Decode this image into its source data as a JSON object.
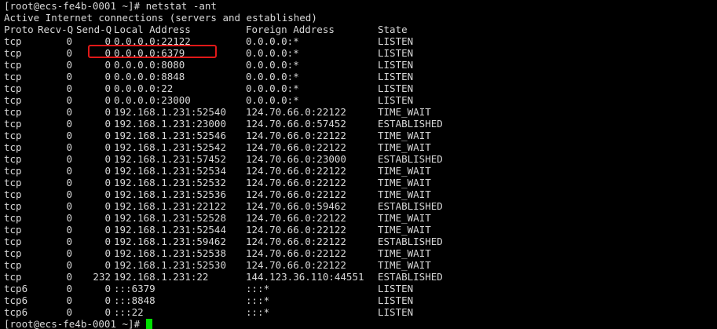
{
  "prompt_line": "[root@ecs-fe4b-0001 ~]# netstat -ant",
  "title_line": "Active Internet connections (servers and established)",
  "header": {
    "proto": "Proto",
    "recv": "Recv-Q",
    "send": "Send-Q",
    "local": "Local Address",
    "foreign": "Foreign Address",
    "state": "State"
  },
  "rows": [
    {
      "proto": "tcp",
      "recv": "0",
      "send": "0",
      "local": "0.0.0.0:22122",
      "foreign": "0.0.0.0:*",
      "state": "LISTEN"
    },
    {
      "proto": "tcp",
      "recv": "0",
      "send": "0",
      "local": "0.0.0.0:6379",
      "foreign": "0.0.0.0:*",
      "state": "LISTEN"
    },
    {
      "proto": "tcp",
      "recv": "0",
      "send": "0",
      "local": "0.0.0.0:8080",
      "foreign": "0.0.0.0:*",
      "state": "LISTEN"
    },
    {
      "proto": "tcp",
      "recv": "0",
      "send": "0",
      "local": "0.0.0.0:8848",
      "foreign": "0.0.0.0:*",
      "state": "LISTEN"
    },
    {
      "proto": "tcp",
      "recv": "0",
      "send": "0",
      "local": "0.0.0.0:22",
      "foreign": "0.0.0.0:*",
      "state": "LISTEN"
    },
    {
      "proto": "tcp",
      "recv": "0",
      "send": "0",
      "local": "0.0.0.0:23000",
      "foreign": "0.0.0.0:*",
      "state": "LISTEN"
    },
    {
      "proto": "tcp",
      "recv": "0",
      "send": "0",
      "local": "192.168.1.231:52540",
      "foreign": "124.70.66.0:22122",
      "state": "TIME_WAIT"
    },
    {
      "proto": "tcp",
      "recv": "0",
      "send": "0",
      "local": "192.168.1.231:23000",
      "foreign": "124.70.66.0:57452",
      "state": "ESTABLISHED"
    },
    {
      "proto": "tcp",
      "recv": "0",
      "send": "0",
      "local": "192.168.1.231:52546",
      "foreign": "124.70.66.0:22122",
      "state": "TIME_WAIT"
    },
    {
      "proto": "tcp",
      "recv": "0",
      "send": "0",
      "local": "192.168.1.231:52542",
      "foreign": "124.70.66.0:22122",
      "state": "TIME_WAIT"
    },
    {
      "proto": "tcp",
      "recv": "0",
      "send": "0",
      "local": "192.168.1.231:57452",
      "foreign": "124.70.66.0:23000",
      "state": "ESTABLISHED"
    },
    {
      "proto": "tcp",
      "recv": "0",
      "send": "0",
      "local": "192.168.1.231:52534",
      "foreign": "124.70.66.0:22122",
      "state": "TIME_WAIT"
    },
    {
      "proto": "tcp",
      "recv": "0",
      "send": "0",
      "local": "192.168.1.231:52532",
      "foreign": "124.70.66.0:22122",
      "state": "TIME_WAIT"
    },
    {
      "proto": "tcp",
      "recv": "0",
      "send": "0",
      "local": "192.168.1.231:52536",
      "foreign": "124.70.66.0:22122",
      "state": "TIME_WAIT"
    },
    {
      "proto": "tcp",
      "recv": "0",
      "send": "0",
      "local": "192.168.1.231:22122",
      "foreign": "124.70.66.0:59462",
      "state": "ESTABLISHED"
    },
    {
      "proto": "tcp",
      "recv": "0",
      "send": "0",
      "local": "192.168.1.231:52528",
      "foreign": "124.70.66.0:22122",
      "state": "TIME_WAIT"
    },
    {
      "proto": "tcp",
      "recv": "0",
      "send": "0",
      "local": "192.168.1.231:52544",
      "foreign": "124.70.66.0:22122",
      "state": "TIME_WAIT"
    },
    {
      "proto": "tcp",
      "recv": "0",
      "send": "0",
      "local": "192.168.1.231:59462",
      "foreign": "124.70.66.0:22122",
      "state": "ESTABLISHED"
    },
    {
      "proto": "tcp",
      "recv": "0",
      "send": "0",
      "local": "192.168.1.231:52538",
      "foreign": "124.70.66.0:22122",
      "state": "TIME_WAIT"
    },
    {
      "proto": "tcp",
      "recv": "0",
      "send": "0",
      "local": "192.168.1.231:52530",
      "foreign": "124.70.66.0:22122",
      "state": "TIME_WAIT"
    },
    {
      "proto": "tcp",
      "recv": "0",
      "send": "232",
      "local": "192.168.1.231:22",
      "foreign": "144.123.36.110:44551",
      "state": "ESTABLISHED"
    },
    {
      "proto": "tcp6",
      "recv": "0",
      "send": "0",
      "local": ":::6379",
      "foreign": ":::*",
      "state": "LISTEN"
    },
    {
      "proto": "tcp6",
      "recv": "0",
      "send": "0",
      "local": ":::8848",
      "foreign": ":::*",
      "state": "LISTEN"
    },
    {
      "proto": "tcp6",
      "recv": "0",
      "send": "0",
      "local": ":::22",
      "foreign": ":::*",
      "state": "LISTEN"
    }
  ],
  "final_prompt": "[root@ecs-fe4b-0001 ~]# ",
  "colors": {
    "background": "#000000",
    "text": "#d8d8d8",
    "cursor": "#00e000",
    "highlight": "#e01818"
  },
  "highlighted_row_index": 1
}
